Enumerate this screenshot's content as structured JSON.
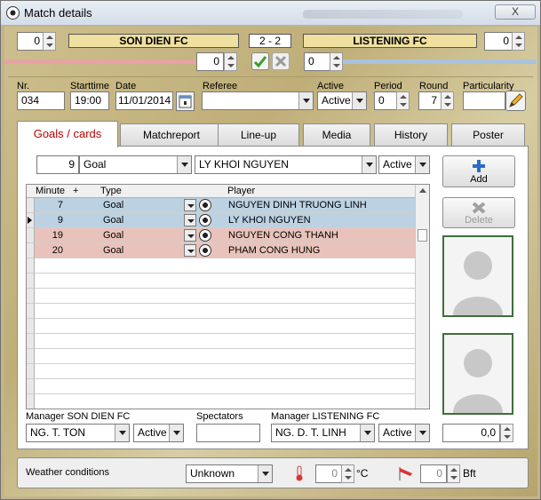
{
  "window": {
    "title": "Match details",
    "close_label": "X"
  },
  "score": {
    "home_value": "0",
    "home_team": "SON DIEN FC",
    "result": "2  - 2",
    "away_team": "LISTENING FC",
    "away_value": "0",
    "home_sub": "0",
    "away_sub": "0",
    "home_bar_color": "#e6a3a3",
    "away_bar_color": "#a9c3dc"
  },
  "info": {
    "nr_label": "Nr.",
    "nr": "034",
    "start_label": "Starttime",
    "start": "19:00",
    "date_label": "Date",
    "date": "11/01/2014",
    "referee_label": "Referee",
    "referee": "",
    "active_label": "Active",
    "active": "Active",
    "period_label": "Period",
    "period": "0",
    "round_label": "Round",
    "round": "7",
    "particularity_label": "Particularity",
    "particularity": ""
  },
  "tabs": [
    "Goals / cards",
    "Matchreport",
    "Line-up",
    "Media",
    "History",
    "Poster"
  ],
  "entry": {
    "minute": "9",
    "type": "Goal",
    "player": "LY KHOI NGUYEN",
    "active": "Active"
  },
  "grid": {
    "headers": {
      "minute": "Minute",
      "plus": "+",
      "type": "Type",
      "player": "Player"
    },
    "rows": [
      {
        "minute": "7",
        "type": "Goal",
        "player": "NGUYEN DINH TRUONG LINH",
        "side": "away"
      },
      {
        "minute": "9",
        "type": "Goal",
        "player": "LY KHOI NGUYEN",
        "side": "away"
      },
      {
        "minute": "19",
        "type": "Goal",
        "player": "NGUYEN CONG THANH",
        "side": "home"
      },
      {
        "minute": "20",
        "type": "Goal",
        "player": "PHAM CONG HUNG",
        "side": "home"
      }
    ],
    "home_row_color": "#e9c3bb",
    "away_row_color": "#bcd2e3"
  },
  "buttons": {
    "add": "Add",
    "delete": "Delete"
  },
  "managers": {
    "home_label": "Manager SON DIEN FC",
    "home": "NG. T. TON",
    "home_active": "Active",
    "spectators_label": "Spectators",
    "spectators": "",
    "away_label": "Manager LISTENING FC",
    "away": "NG. D. T. LINH",
    "away_active": "Active"
  },
  "rating": "0,0",
  "weather": {
    "label": "Weather conditions",
    "condition": "Unknown",
    "temp": "0",
    "temp_unit": "°C",
    "wind": "0",
    "wind_unit": "Bft"
  }
}
